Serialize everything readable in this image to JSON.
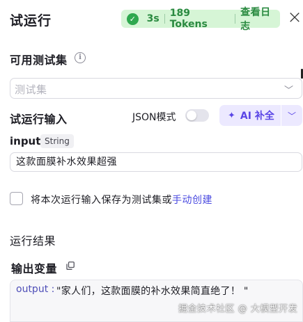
{
  "header": {
    "title": "试运行",
    "duration": "3s",
    "tokens": "189 Tokens",
    "log_link": "查看日志",
    "status_color": "#2fa84f"
  },
  "dataset": {
    "label": "可用测试集",
    "placeholder": "测试集"
  },
  "run_input": {
    "label": "试运行输入",
    "json_mode_label": "JSON模式",
    "json_mode_on": false,
    "ai_button_label": "AI 补全",
    "accent": "#5a46e6"
  },
  "variable": {
    "name": "input",
    "type": "String",
    "value": "这款面膜补水效果超强"
  },
  "save": {
    "checked": false,
    "text": "将本次运行输入保存为测试集或",
    "link": "手动创建"
  },
  "result": {
    "section_title": "运行结果",
    "output_title": "输出变量",
    "output_key": "output :",
    "output_value": "\"家人们，这款面膜的补水效果简直绝了！ \""
  },
  "watermark": "掘金技术社区 @ 大模型开发"
}
